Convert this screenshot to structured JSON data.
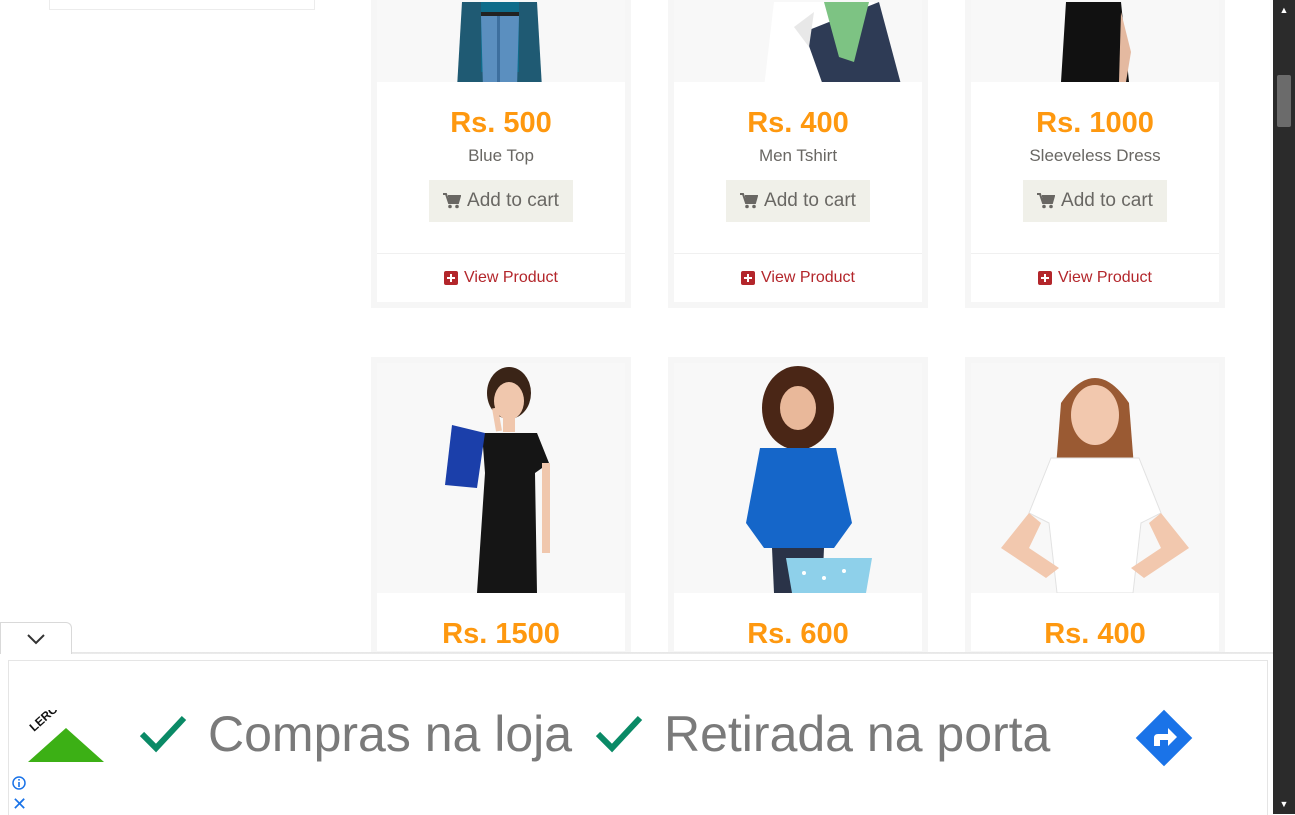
{
  "products": [
    {
      "price": "Rs. 500",
      "name": "Blue Top",
      "cart_label": "Add to cart",
      "view_label": "View Product"
    },
    {
      "price": "Rs. 400",
      "name": "Men Tshirt",
      "cart_label": "Add to cart",
      "view_label": "View Product"
    },
    {
      "price": "Rs. 1000",
      "name": "Sleeveless Dress",
      "cart_label": "Add to cart",
      "view_label": "View Product"
    },
    {
      "price": "Rs. 1500"
    },
    {
      "price": "Rs. 600"
    },
    {
      "price": "Rs. 400"
    }
  ],
  "ad": {
    "brand": "LEROY MERLIN",
    "text1": "Compras na loja",
    "text2": "Retirada na porta"
  },
  "colors": {
    "price": "#FE980F",
    "view": "#B3262B",
    "cart_bg": "#F0F0E9",
    "ad_check": "#00875a",
    "ad_go": "#1a73e8"
  }
}
